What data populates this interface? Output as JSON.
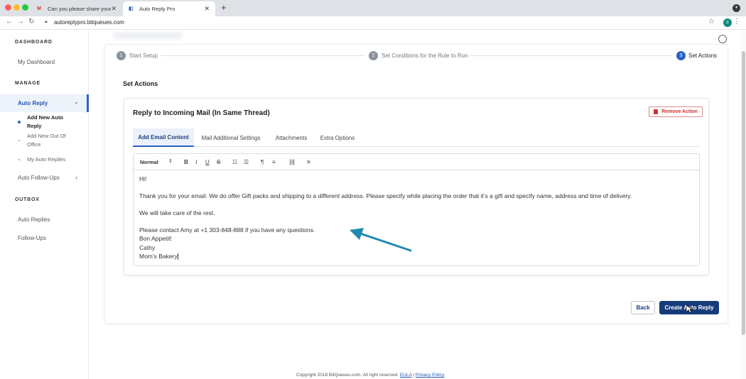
{
  "browser": {
    "tabs": [
      {
        "title": "Can you please share your me",
        "icon": "gmail-icon"
      },
      {
        "title": "Auto Reply Pro",
        "icon": "bitqueues-icon"
      }
    ],
    "url": "autoreplypro.bitqueues.com",
    "profile_initial": "c"
  },
  "sidebar": {
    "dashboard_header": "DASHBOARD",
    "my_dashboard": "My Dashboard",
    "manage_header": "MANAGE",
    "auto_reply": "Auto Reply",
    "sub_items": [
      "Add New Auto Reply",
      "Add New Out Of Office",
      "My Auto Replies"
    ],
    "auto_followups": "Auto Follow-Ups",
    "outbox_header": "OUTBOX",
    "auto_replies": "Auto Replies",
    "follow_ups": "Follow-Ups"
  },
  "steps": [
    {
      "num": "1",
      "label": "Start Setup"
    },
    {
      "num": "2",
      "label": "Set Conditions for the Rule to Run"
    },
    {
      "num": "3",
      "label": "Set Actions"
    }
  ],
  "section_title": "Set Actions",
  "action": {
    "title": "Reply to Incoming Mail (In Same Thread)",
    "remove_label": "Remove Action",
    "tabs": [
      "Add Email Content",
      "Mail Additional Settings",
      "Attachments",
      "Extra Options"
    ]
  },
  "editor": {
    "format": "Normal",
    "lines": [
      "Hi!",
      "Thank you for your email. We do offer Gift packs and shipping to a different address. Please specify while placing the order that it’s a gift and specify name, address and time of delivery.",
      "We will take care of the rest.",
      "Please contact Amy at +1 303-848-888 if you have any questions.",
      "Bon Appetit!",
      "Cathy",
      "Mom’s Bakery"
    ]
  },
  "buttons": {
    "back": "Back",
    "create": "Create Auto Reply"
  },
  "footer": {
    "copyright": "Copyright 2018 BitQueues.com. All right reserved.",
    "eula": "EULA",
    "separator": "|",
    "privacy": "Privacy Policy"
  },
  "colors": {
    "primary": "#153b7a",
    "accent": "#2b63c4",
    "danger": "#d23030",
    "arrow": "#1f8ab0"
  }
}
